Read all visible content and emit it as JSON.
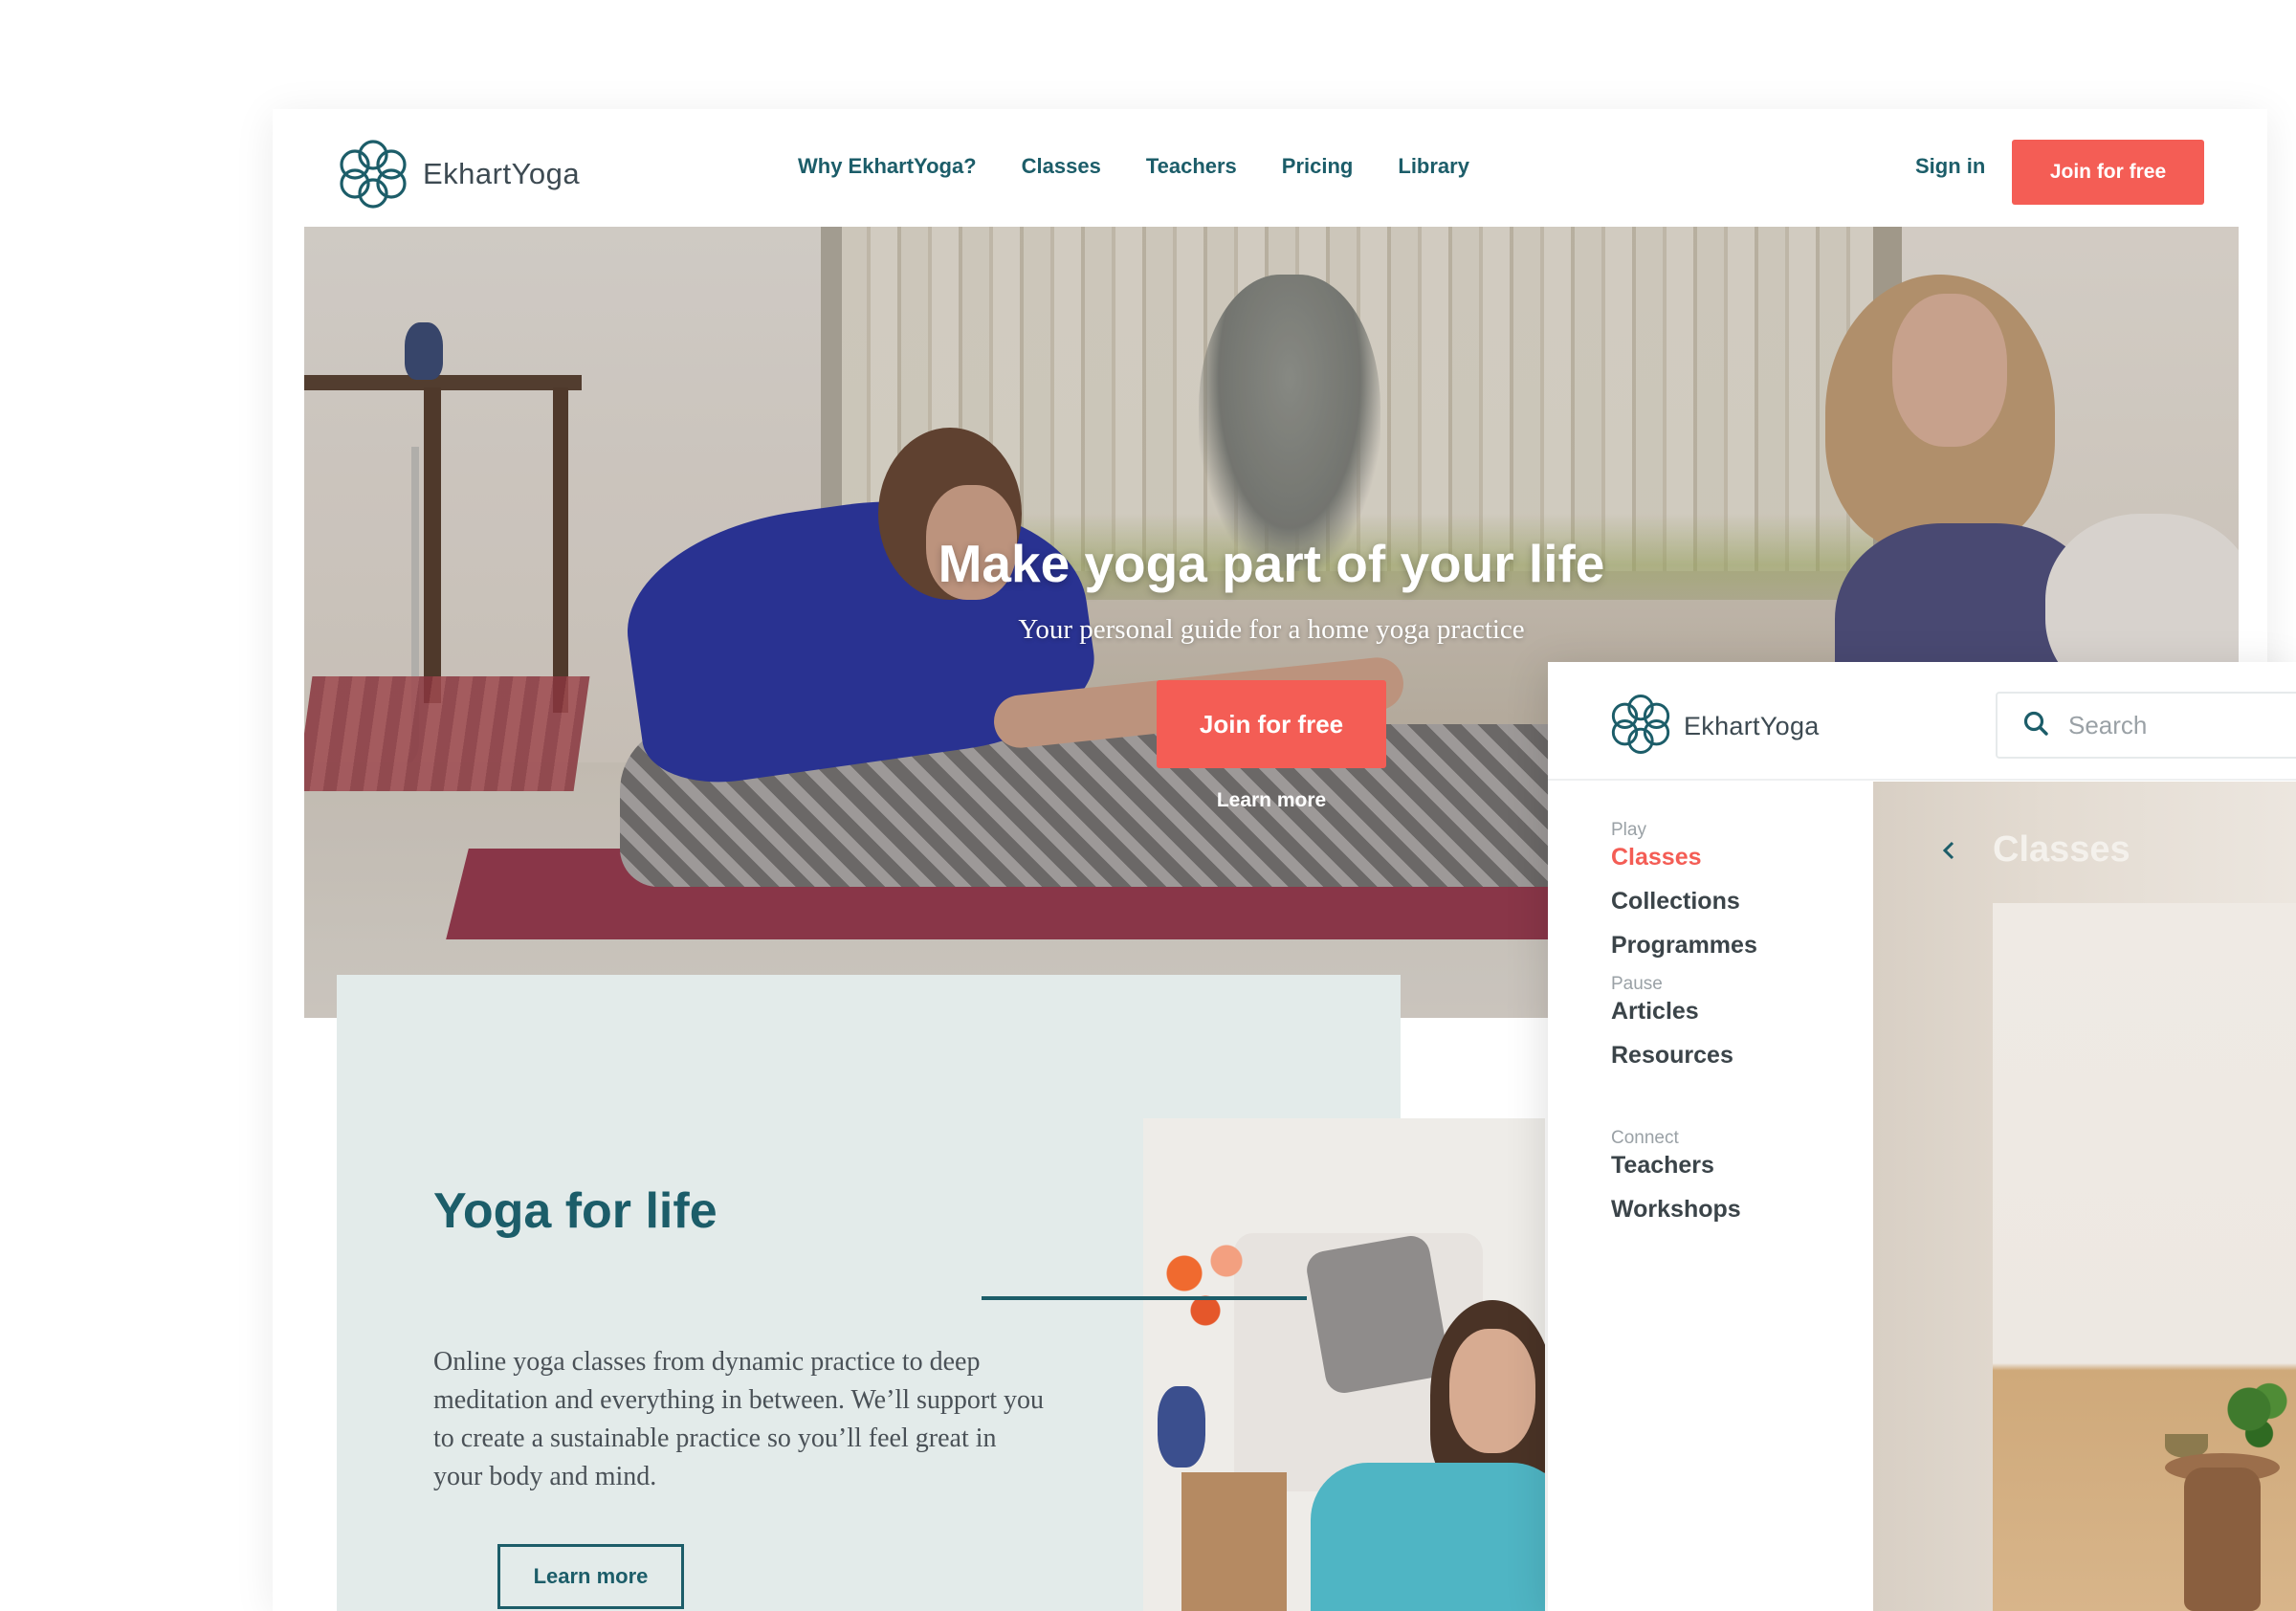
{
  "main_site": {
    "brand": "EkhartYoga",
    "nav": [
      "Why EkhartYoga?",
      "Classes",
      "Teachers",
      "Pricing",
      "Library"
    ],
    "sign_in": "Sign in",
    "join_top": "Join for free",
    "hero": {
      "title": "Make yoga part of your life",
      "subtitle": "Your personal guide for a home yoga practice",
      "join": "Join for free",
      "learn_more": "Learn more"
    },
    "life": {
      "title": "Yoga for life",
      "body": "Online yoga classes from dynamic practice to deep meditation and everything in between. We’ll support you to create a sustainable practice so you’ll feel great in your body and mind.",
      "button": "Learn more"
    }
  },
  "overlay": {
    "brand": "EkhartYoga",
    "search": {
      "placeholder": "Search",
      "value": ""
    },
    "groups": [
      {
        "label": "Play",
        "items": [
          "Classes",
          "Collections",
          "Programmes"
        ]
      },
      {
        "label": "Pause",
        "items": [
          "Articles",
          "Resources"
        ]
      },
      {
        "label": "Connect",
        "items": [
          "Teachers",
          "Workshops"
        ]
      }
    ],
    "active_item": "Classes",
    "content_title": "Classes",
    "back_icon": "chevron-left-icon"
  },
  "colors": {
    "brand_teal": "#1c5d69",
    "accent_coral": "#f45d55",
    "section_bg": "#e3ebea"
  }
}
